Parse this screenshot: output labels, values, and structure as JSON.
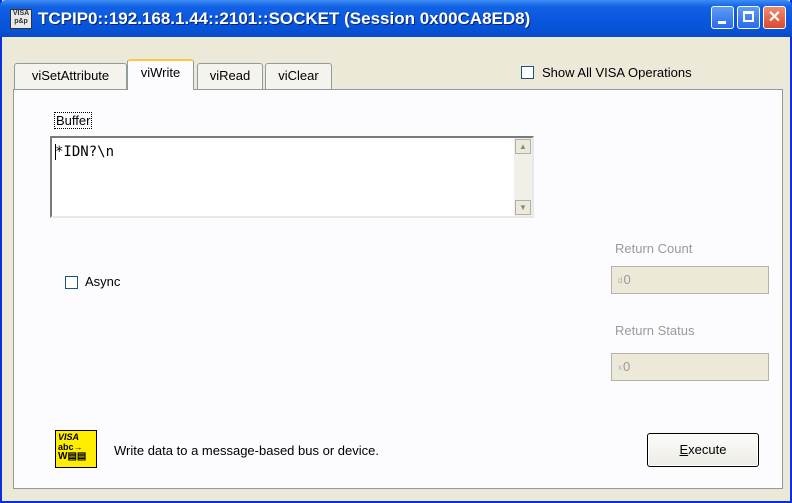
{
  "window": {
    "title": "TCPIP0::192.168.1.44::2101::SOCKET (Session 0x00CA8ED8)",
    "icon_text": "VISA p&p"
  },
  "tabs": [
    {
      "label": "viSetAttribute",
      "active": false
    },
    {
      "label": "viWrite",
      "active": true
    },
    {
      "label": "viRead",
      "active": false
    },
    {
      "label": "viClear",
      "active": false
    }
  ],
  "show_all_visa": {
    "label": "Show All VISA Operations",
    "checked": false
  },
  "buffer": {
    "label": "Buffer",
    "value": "*IDN?\\n"
  },
  "async": {
    "label": "Async",
    "checked": false
  },
  "return_count": {
    "label": "Return Count",
    "prefix": "d",
    "value": "0"
  },
  "return_status": {
    "label": "Return Status",
    "prefix": "x",
    "value": "0"
  },
  "footer": {
    "icon_lines": [
      "VISA",
      "abc→",
      "W▤▤"
    ],
    "description": "Write data to a message-based bus or device.",
    "execute_label": "Execute",
    "execute_mnemonic": "E",
    "execute_rest": "xecute"
  },
  "colors": {
    "title_bar": "#0a58e0",
    "tab_highlight": "#ffc83c",
    "window_bg": "#ece9d8"
  }
}
